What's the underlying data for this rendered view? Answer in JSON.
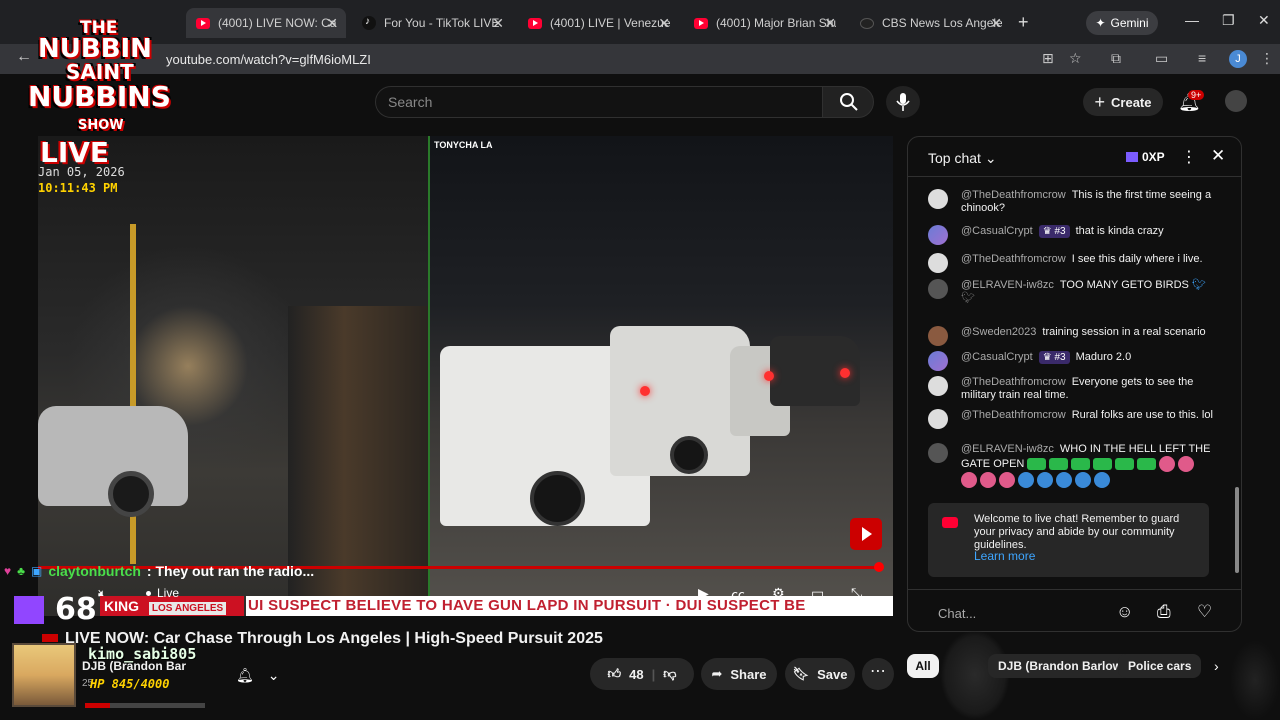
{
  "browser": {
    "tabs": [
      {
        "label": "(4001) LIVE NOW: Ca",
        "icon": "youtube-icon",
        "active": true
      },
      {
        "label": "For You - TikTok LIVE",
        "icon": "tiktok-icon",
        "active": false
      },
      {
        "label": "(4001) LIVE | Venezuela",
        "icon": "youtube-icon",
        "active": false
      },
      {
        "label": "(4001) Major Brian Shul",
        "icon": "youtube-icon",
        "active": false
      },
      {
        "label": "CBS News Los Angeles",
        "icon": "cbs-icon",
        "active": false
      }
    ],
    "gemini_label": "Gemini",
    "url": "youtube.com/watch?v=glfM6ioMLZI",
    "profile_initial": "J"
  },
  "header": {
    "search_placeholder": "Search",
    "create_label": "Create",
    "notification_count": "9+"
  },
  "overlay": {
    "logo_lines": [
      "THE",
      "NUBBIN",
      "SAINT",
      "NUBBINS",
      "SHOW"
    ],
    "live_label": "LIVE",
    "date": "Jan 05, 2026",
    "time": "10:11:43 PM",
    "tiktok_tag": "TONYCHA LA",
    "chat_user": "claytonburtch",
    "chat_message": ": They out ran the radio...",
    "viewer_count": "68",
    "player_live_label": "Live",
    "ticker_badge": "KING",
    "ticker_badge_sub": "LOS ANGELES",
    "ticker_text": "UI SUSPECT BELIEVE TO HAVE GUN LAPD IN PURSUIT  ·  DUI SUSPECT BE",
    "overlay_user2": "kimo_sabi805",
    "hp_label": "HP 845/4000",
    "hp_fraction": 0.21
  },
  "video": {
    "title": "LIVE NOW: Car Chase Through Los Angeles | High-Speed Pursuit 2025",
    "channel_name": "DJB (Brandon Bar",
    "channel_sub": "25",
    "like_count": "48",
    "share_label": "Share",
    "save_label": "Save"
  },
  "chat": {
    "mode_label": "Top chat",
    "xp_label": "0XP",
    "messages": [
      {
        "author": "@TheDeathfromcrow",
        "rank": "",
        "text": "This is the first time seeing a chinook?",
        "avatar": "light"
      },
      {
        "author": "@CasualCrypt",
        "rank": "#3",
        "text": "that is kinda crazy",
        "avatar": "violet"
      },
      {
        "author": "@TheDeathfromcrow",
        "rank": "",
        "text": "I see this daily where i live.",
        "avatar": "light"
      },
      {
        "author": "@ELRAVEN-iw8zc",
        "rank": "",
        "text": "TOO MANY GETO BIRDS",
        "avatar": "dark"
      },
      {
        "author": "@Sweden2023",
        "rank": "",
        "text": "training session in a real scenario",
        "avatar": "brown"
      },
      {
        "author": "@CasualCrypt",
        "rank": "#3",
        "text": "Maduro 2.0",
        "avatar": "violet"
      },
      {
        "author": "@TheDeathfromcrow",
        "rank": "",
        "text": "Everyone gets to see the military train real time.",
        "avatar": "light"
      },
      {
        "author": "@TheDeathfromcrow",
        "rank": "",
        "text": "Rural folks are use to this. lol",
        "avatar": "light"
      },
      {
        "author": "@ELRAVEN-iw8zc",
        "rank": "",
        "text": "WHO IN THE HELL LEFT THE GATE OPEN",
        "avatar": "dark"
      }
    ],
    "welcome_text": "Welcome to live chat! Remember to guard your privacy and abide by our community guidelines.",
    "learn_more": "Learn more",
    "input_placeholder": "Chat..."
  },
  "chips": {
    "all": "All",
    "items": [
      "DJB (Brandon Barlow)",
      "Police cars"
    ]
  },
  "colors": {
    "accent_red": "#cc0000",
    "link_blue": "#3ea6ff",
    "overlay_green": "#4ade4a",
    "twitch_purple": "#9146ff"
  }
}
